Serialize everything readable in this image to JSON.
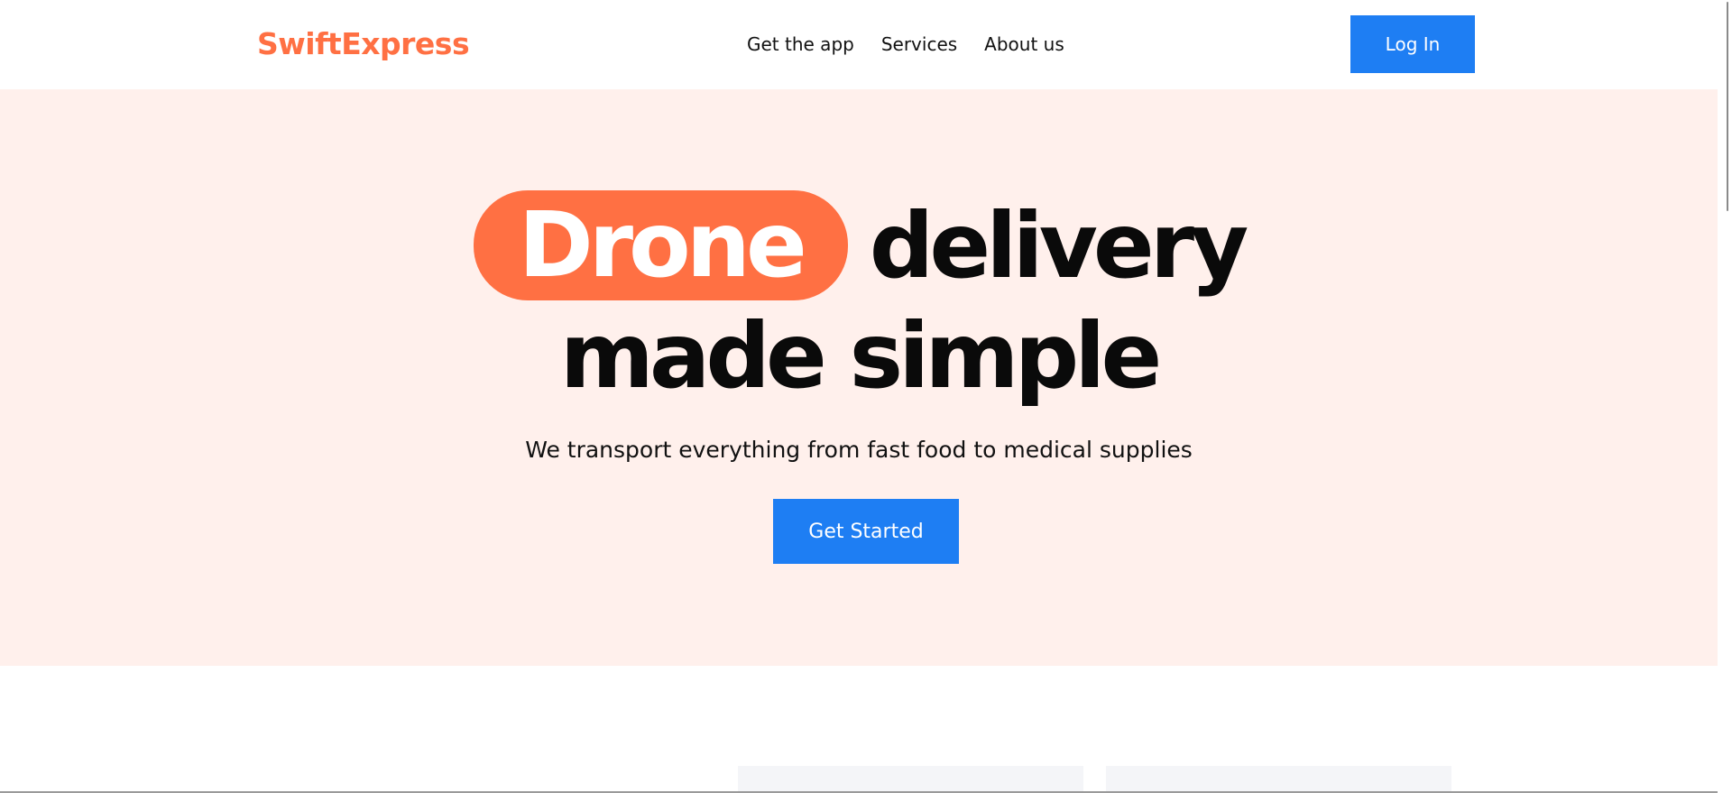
{
  "header": {
    "logo": "SwiftExpress",
    "nav": [
      "Get the app",
      "Services",
      "About us"
    ],
    "login_label": "Log In"
  },
  "hero": {
    "highlight_word": "Drone",
    "headline_rest": "delivery",
    "headline_line2": "made simple",
    "subtitle": "We transport everything from fast food to medical supplies",
    "cta_label": "Get Started"
  },
  "colors": {
    "brand": "#ff7043",
    "accent_blue": "#1e7ef3",
    "hero_bg": "#fff0ec"
  }
}
